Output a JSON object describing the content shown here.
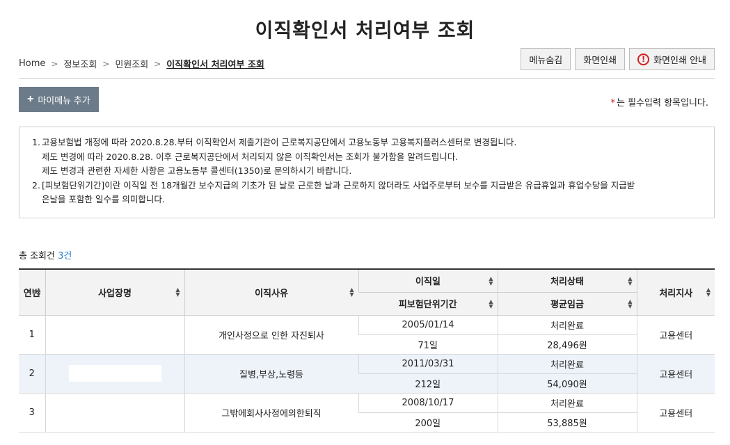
{
  "page": {
    "title": "이직확인서 처리여부 조회"
  },
  "breadcrumb": [
    "Home",
    "정보조회",
    "민원조회",
    "이직확인서 처리여부 조회"
  ],
  "top_buttons": {
    "menu_hide": "메뉴숨김",
    "print": "화면인쇄",
    "print_guide": "화면인쇄 안내"
  },
  "mymenu": {
    "label": "마이메뉴 추가"
  },
  "required_note": {
    "star": "*",
    "text": "는 필수입력 항목입니다."
  },
  "notice": {
    "item1_num": "1.",
    "item1_line1": "고용보험법 개정에 따라 2020.8.28.부터 이직확인서 제출기관이 근로복지공단에서 고용노동부 고용복지플러스센터로 변경됩니다.",
    "item1_line2": "제도 변경에 따라 2020.8.28. 이후 근로복지공단에서 처리되지 않은 이직확인서는 조회가 불가함을 알려드립니다.",
    "item1_line3": "제도 변경과 관련한 자세한 사항은 고용노동부 콜센터(1350)로 문의하시기 바랍니다.",
    "item2_num": "2.",
    "item2_line1": "[피보험단위기간]이란 이직일 전 18개월간 보수지급의 기초가 된 날로 근로한 날과 근로하지 않더라도 사업주로부터 보수를 지급받은 유급휴일과 휴업수당을 지급받",
    "item2_line2": "은날을 포함한 일수를 의미합니다."
  },
  "total": {
    "label": "총 조회건",
    "count": "3건"
  },
  "table": {
    "headers": {
      "no": "연번",
      "company": "사업장명",
      "reason": "이직사유",
      "leave_date": "이직일",
      "insured_period": "피보험단위기간",
      "status": "처리상태",
      "avg_wage": "평균임금",
      "branch": "처리지사"
    },
    "rows": [
      {
        "no": "1",
        "company": "",
        "reason": "개인사정으로 인한 자진퇴사",
        "leave_date": "2005/01/14",
        "insured_period": "71일",
        "status": "처리완료",
        "avg_wage": "28,496원",
        "branch": "고용센터"
      },
      {
        "no": "2",
        "company": "",
        "reason": "질병,부상,노령등",
        "leave_date": "2011/03/31",
        "insured_period": "212일",
        "status": "처리완료",
        "avg_wage": "54,090원",
        "branch": "고용센터"
      },
      {
        "no": "3",
        "company": "",
        "reason": "그밖에회사사정에의한퇴직",
        "leave_date": "2008/10/17",
        "insured_period": "200일",
        "status": "처리완료",
        "avg_wage": "53,885원",
        "branch": "고용센터"
      }
    ]
  }
}
